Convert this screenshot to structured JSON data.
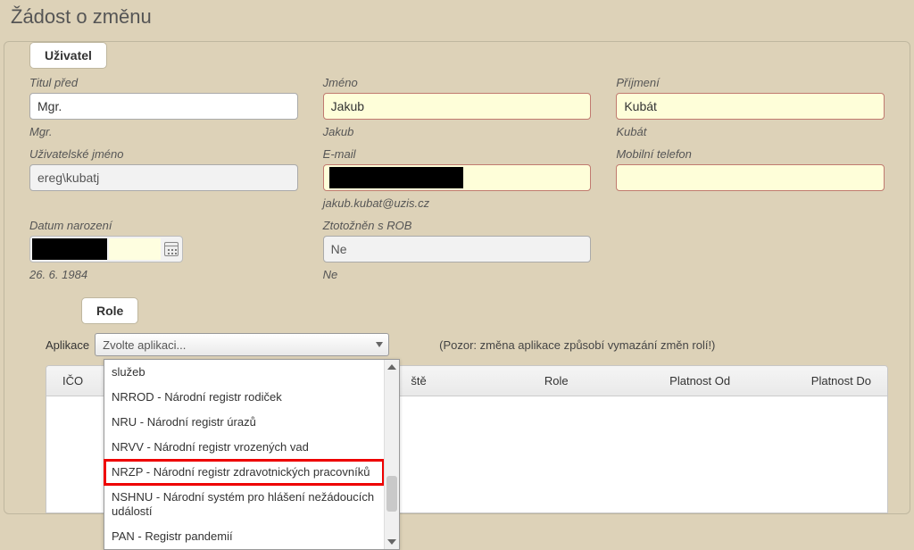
{
  "page": {
    "title": "Žádost o změnu"
  },
  "user_section": {
    "legend": "Uživatel",
    "titul_pred": {
      "label": "Titul před",
      "value": "Mgr.",
      "sub": "Mgr."
    },
    "jmeno": {
      "label": "Jméno",
      "value": "Jakub",
      "sub": "Jakub"
    },
    "prijmeni": {
      "label": "Příjmení",
      "value": "Kubát",
      "sub": "Kubát"
    },
    "username": {
      "label": "Uživatelské jméno",
      "value": "ereg\\kubatj"
    },
    "email": {
      "label": "E-mail",
      "sub": "jakub.kubat@uzis.cz"
    },
    "phone": {
      "label": "Mobilní telefon",
      "value": ""
    },
    "dob": {
      "label": "Datum narození",
      "sub": "26. 6. 1984"
    },
    "rob": {
      "label": "Ztotožněn s ROB",
      "value": "Ne",
      "sub": "Ne"
    }
  },
  "role_section": {
    "legend": "Role",
    "aplikace_label": "Aplikace",
    "select_placeholder": "Zvolte aplikaci...",
    "warning": "(Pozor: změna aplikace způsobí vymazání změn rolí!)",
    "columns": {
      "ico": "IČO",
      "jmeno_suffix": "ště",
      "role": "Role",
      "platnost_od": "Platnost Od",
      "platnost_do": "Platnost Do"
    },
    "dropdown": {
      "items": [
        "služeb",
        "NRROD - Národní registr rodiček",
        "NRU - Národní registr úrazů",
        "NRVV - Národní registr vrozených vad",
        "NRZP - Národní registr zdravotnických pracovníků",
        "NSHNU - Národní systém pro hlášení nežádoucích událostí",
        "PAN - Registr pandemií"
      ],
      "highlight_index": 4
    }
  }
}
